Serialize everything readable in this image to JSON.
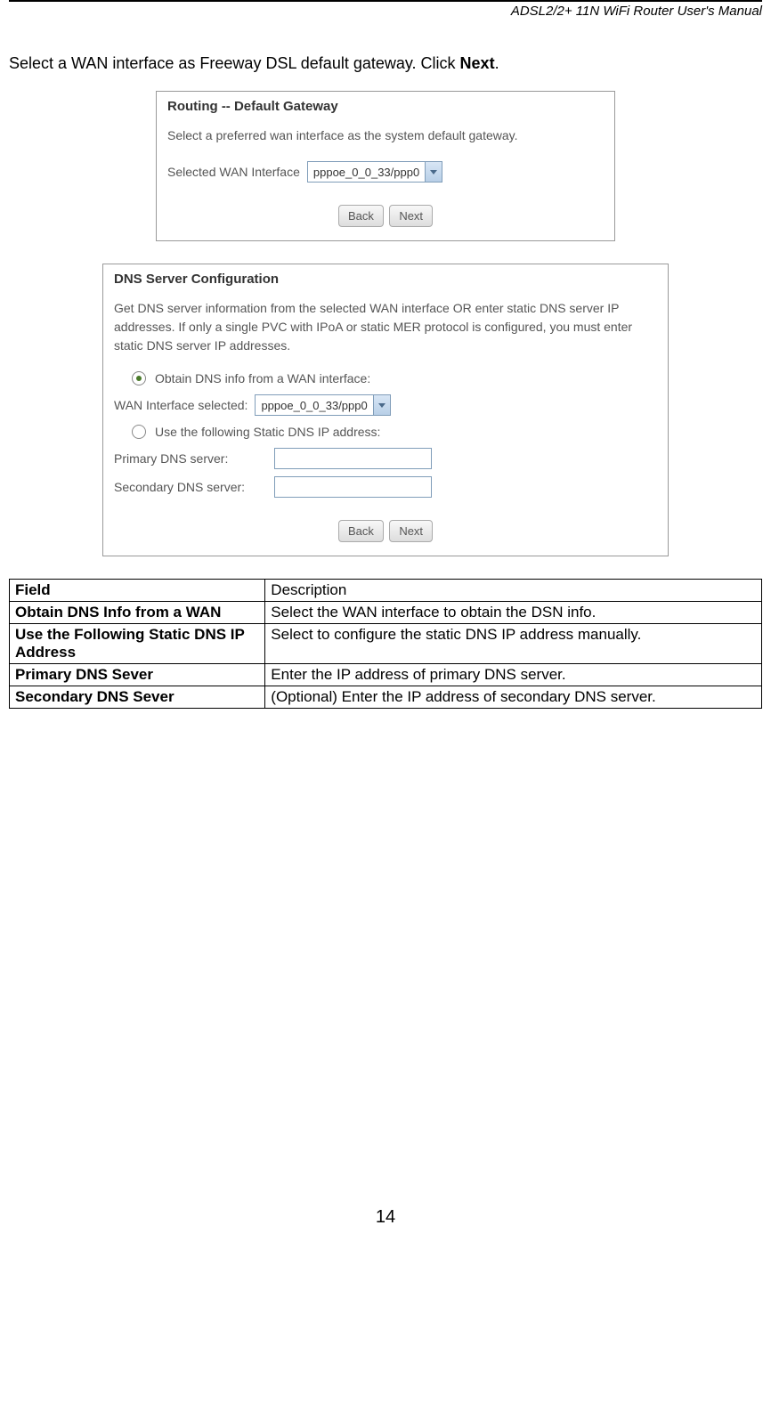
{
  "header": {
    "title": "ADSL2/2+ 11N WiFi Router User's Manual"
  },
  "intro": {
    "text_prefix": "Select a WAN interface as Freeway DSL default gateway. Click ",
    "text_bold": "Next",
    "text_suffix": "."
  },
  "screenshot1": {
    "title": "Routing -- Default Gateway",
    "description": "Select a preferred wan interface as the system default gateway.",
    "field_label": "Selected WAN Interface",
    "select_value": "pppoe_0_0_33/ppp0",
    "back_btn": "Back",
    "next_btn": "Next"
  },
  "screenshot2": {
    "title": "DNS Server Configuration",
    "description": "Get DNS server information from the selected WAN interface OR enter static DNS server IP addresses. If only a single PVC with IPoA or static MER protocol is configured, you must enter static DNS server IP addresses.",
    "radio1_label": "Obtain DNS info from a WAN interface:",
    "wan_label": "WAN Interface selected:",
    "wan_value": "pppoe_0_0_33/ppp0",
    "radio2_label": "Use the following Static DNS IP address:",
    "primary_label": "Primary DNS server:",
    "secondary_label": "Secondary DNS server:",
    "back_btn": "Back",
    "next_btn": "Next"
  },
  "table": {
    "headers": {
      "field": "Field",
      "description": "Description"
    },
    "rows": [
      {
        "field": "Obtain DNS Info from a WAN",
        "description": "Select the WAN interface to obtain the DSN info."
      },
      {
        "field": "Use the Following Static DNS IP Address",
        "description": "Select to configure the static DNS IP address manually."
      },
      {
        "field": "Primary DNS Sever",
        "description": "Enter the IP address of primary DNS server."
      },
      {
        "field": "Secondary DNS Sever",
        "description": "(Optional) Enter the IP address of secondary DNS server."
      }
    ]
  },
  "page_number": "14"
}
